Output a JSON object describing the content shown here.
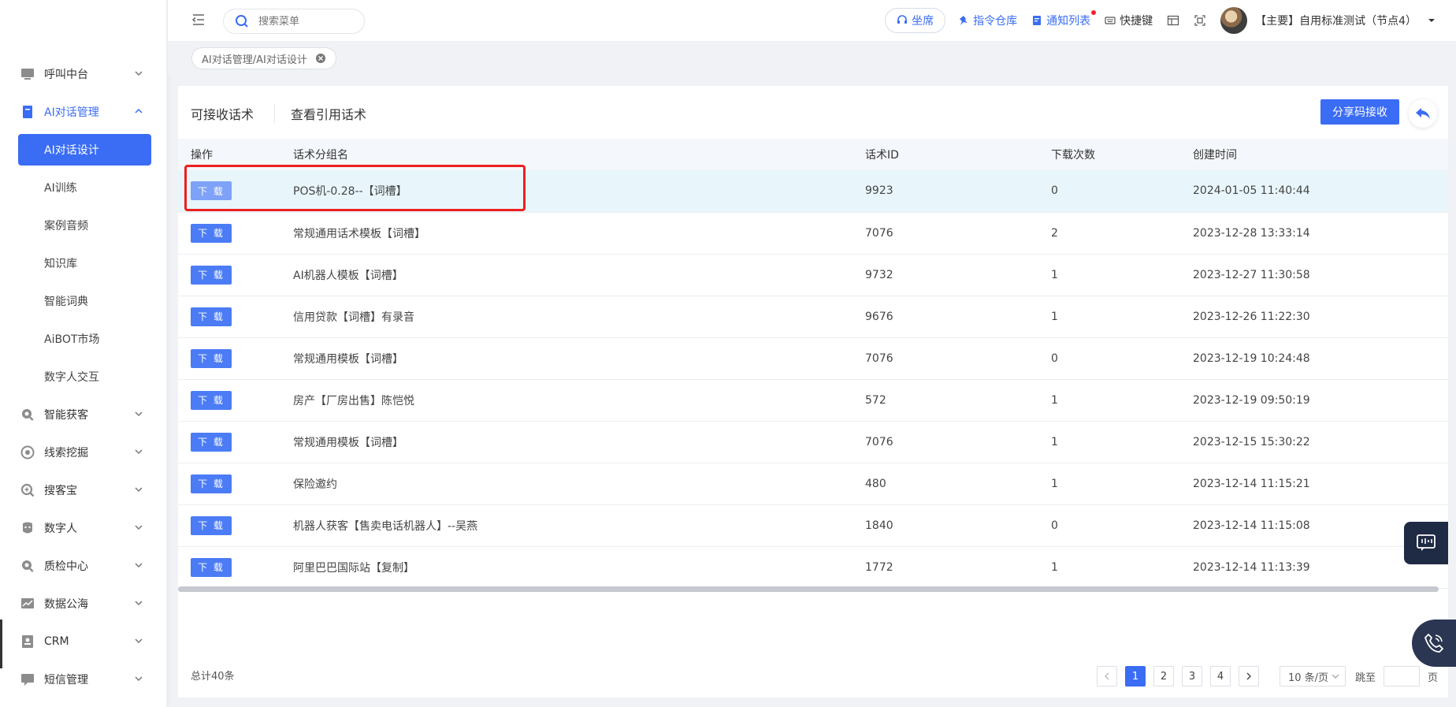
{
  "sidebar": {
    "items": [
      {
        "label": "呼叫中台",
        "icon": "monitor-icon"
      },
      {
        "label": "AI对话管理",
        "icon": "book-icon"
      },
      {
        "label": "智能获客",
        "icon": "magnifier-icon"
      },
      {
        "label": "线索挖掘",
        "icon": "target-icon"
      },
      {
        "label": "搜客宝",
        "icon": "search-plus-icon"
      },
      {
        "label": "数字人",
        "icon": "digital-human-icon"
      },
      {
        "label": "质检中心",
        "icon": "quality-search-icon"
      },
      {
        "label": "数据公海",
        "icon": "chart-icon"
      },
      {
        "label": "CRM",
        "icon": "contact-icon"
      },
      {
        "label": "短信管理",
        "icon": "message-icon"
      }
    ],
    "sub_items": [
      "AI对话设计",
      "AI训练",
      "案例音频",
      "知识库",
      "智能词典",
      "AiBOT市场",
      "数字人交互"
    ]
  },
  "header": {
    "search_placeholder": "搜索菜单",
    "seat_label": "坐席",
    "command_label": "指令仓库",
    "notice_label": "通知列表",
    "shortcut_label": "快捷键",
    "user_label": "【主要】自用标准测试（节点4）"
  },
  "breadcrumb_tag": "AI对话管理/AI对话设计",
  "card": {
    "tab_receivable": "可接收话术",
    "tab_referenced": "查看引用话术",
    "share_button": "分享码接收"
  },
  "table": {
    "headers": [
      "操作",
      "话术分组名",
      "话术ID",
      "下载次数",
      "创建时间"
    ],
    "download_label": "下 载",
    "rows": [
      {
        "name": "POS机-0.28--【词槽】",
        "id": "9923",
        "downloads": "0",
        "created": "2024-01-05 11:40:44"
      },
      {
        "name": "常规通用话术模板【词槽】",
        "id": "7076",
        "downloads": "2",
        "created": "2023-12-28 13:33:14"
      },
      {
        "name": "AI机器人模板【词槽】",
        "id": "9732",
        "downloads": "1",
        "created": "2023-12-27 11:30:58"
      },
      {
        "name": "信用贷款【词槽】有录音",
        "id": "9676",
        "downloads": "1",
        "created": "2023-12-26 11:22:30"
      },
      {
        "name": "常规通用模板【词槽】",
        "id": "7076",
        "downloads": "0",
        "created": "2023-12-19 10:24:48"
      },
      {
        "name": "房产【厂房出售】陈恺悦",
        "id": "572",
        "downloads": "1",
        "created": "2023-12-19 09:50:19"
      },
      {
        "name": "常规通用模板【词槽】",
        "id": "7076",
        "downloads": "1",
        "created": "2023-12-15 15:30:22"
      },
      {
        "name": "保险邀约",
        "id": "480",
        "downloads": "1",
        "created": "2023-12-14 11:15:21"
      },
      {
        "name": "机器人获客【售卖电话机器人】--吴燕",
        "id": "1840",
        "downloads": "0",
        "created": "2023-12-14 11:15:08"
      },
      {
        "name": "阿里巴巴国际站【复制】",
        "id": "1772",
        "downloads": "1",
        "created": "2023-12-14 11:13:39"
      }
    ]
  },
  "footer": {
    "total": "总计40条",
    "pages": [
      "1",
      "2",
      "3",
      "4"
    ],
    "page_size": "10 条/页",
    "jump_label": "跳至",
    "page_suffix": "页"
  },
  "colors": {
    "accent": "#3a6cf4",
    "highlight_row": "#e8f6fb",
    "annotation_red": "#ee1f1f"
  }
}
